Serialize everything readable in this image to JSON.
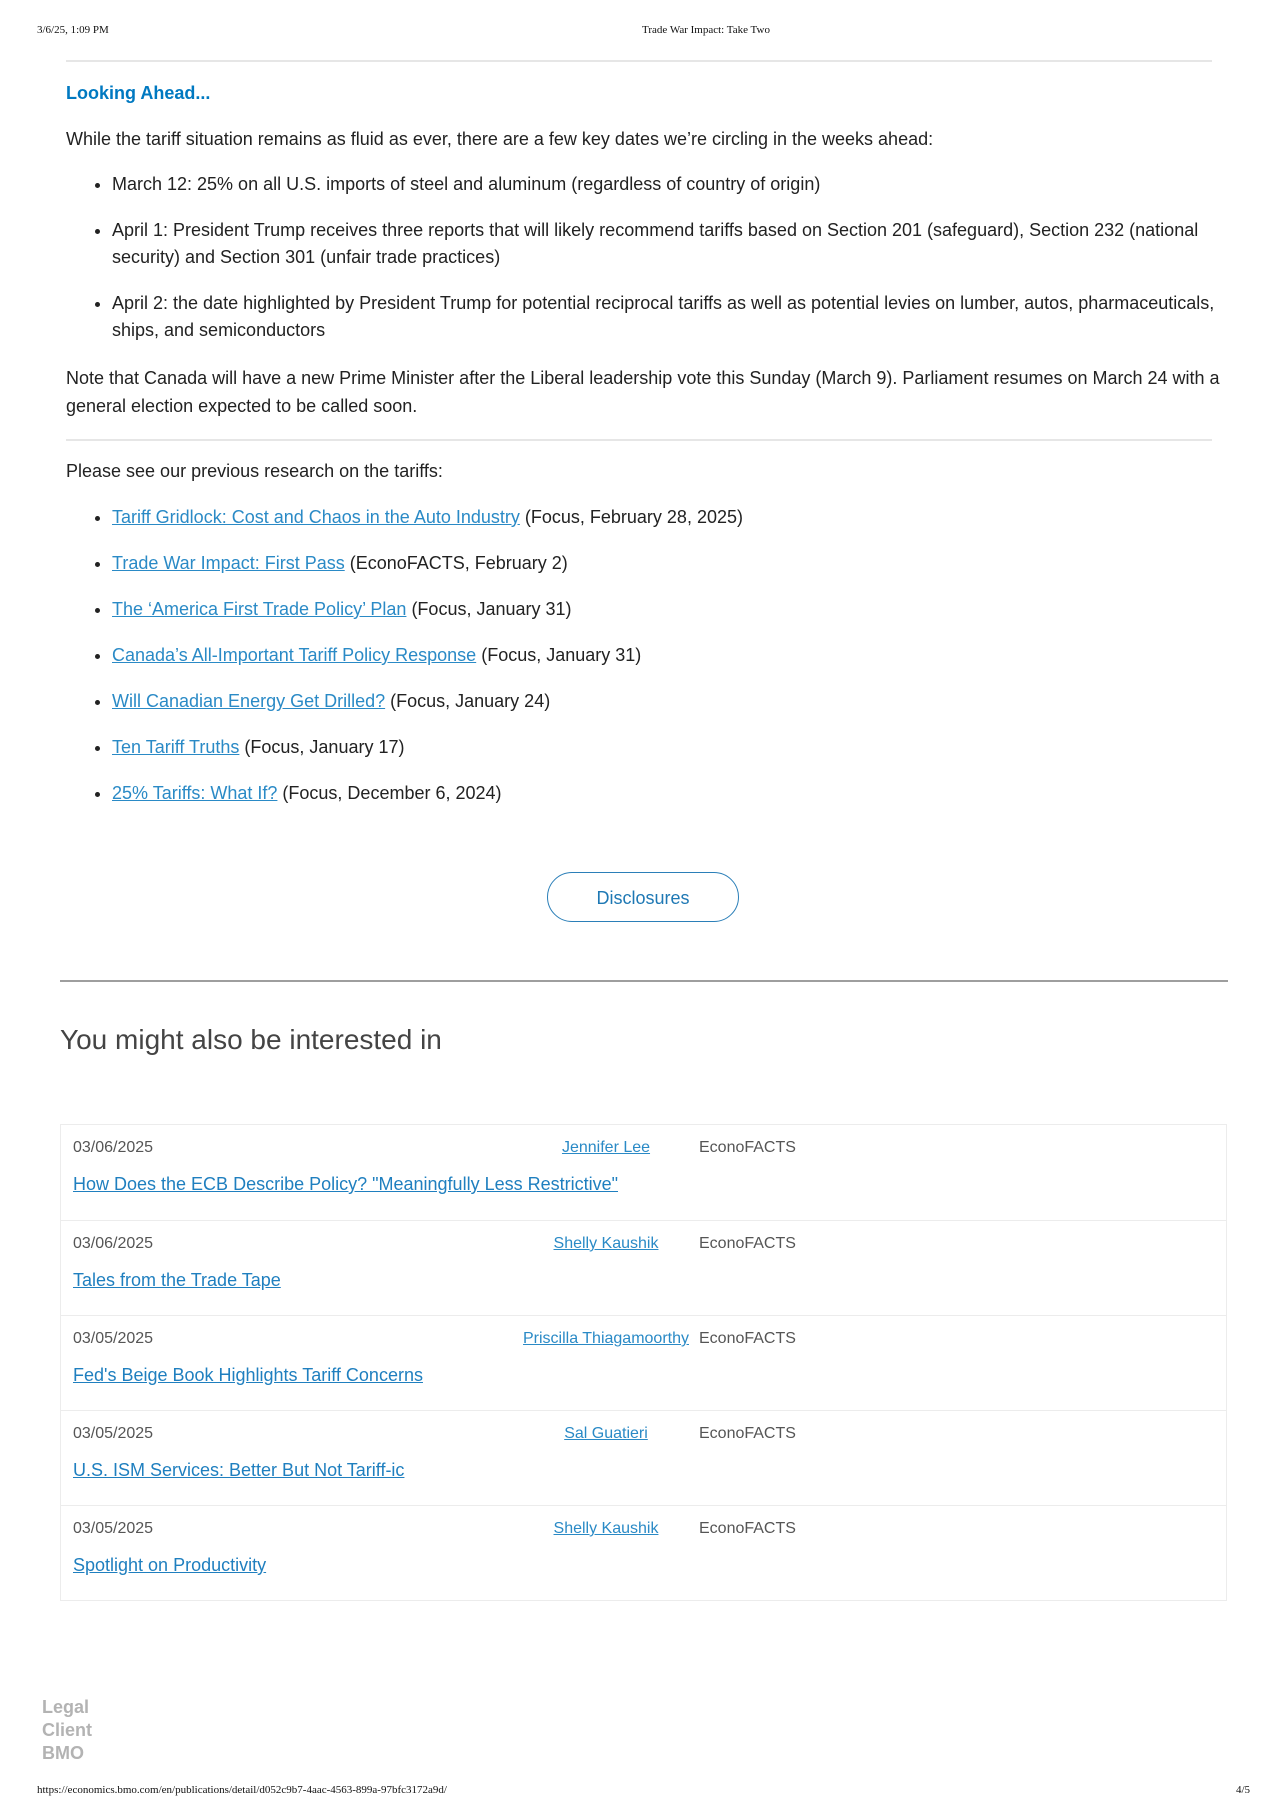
{
  "print_header": {
    "datetime": "3/6/25, 1:09 PM",
    "title": "Trade War Impact: Take Two"
  },
  "looking_ahead": {
    "heading": "Looking Ahead...",
    "intro": "While the tariff situation remains as fluid as ever, there are a few key dates we’re circling in the weeks ahead:",
    "bullets": [
      "March 12: 25% on all U.S. imports of steel and aluminum (regardless of country of origin)",
      "April 1: President Trump receives three reports that will likely recommend tariffs based on Section 201 (safeguard), Section 232 (national security) and Section 301 (unfair trade practices)",
      "April 2: the date highlighted by President Trump for potential reciprocal tariffs as well as potential levies on lumber, autos, pharmaceuticals, ships, and semiconductors"
    ],
    "note": "Note that Canada will have a new Prime Minister after the Liberal leadership vote this Sunday (March 9). Parliament resumes on March 24 with a general election expected to be called soon."
  },
  "previous_research": {
    "intro": "Please see our previous research on the tariffs:",
    "items": [
      {
        "link": "Tariff Gridlock: Cost and Chaos in the Auto Industry",
        "suffix": " (Focus, February 28, 2025)"
      },
      {
        "link": "Trade War Impact: First Pass",
        "suffix": " (EconoFACTS, February 2)"
      },
      {
        "link": "The ‘America First Trade Policy’ Plan",
        "suffix": " (Focus, January 31)"
      },
      {
        "link": "Canada’s All-Important Tariff Policy Response",
        "suffix": " (Focus, January 31)"
      },
      {
        "link": "Will Canadian Energy Get Drilled?",
        "suffix": " (Focus, January 24)"
      },
      {
        "link": "Ten Tariff Truths",
        "suffix": " (Focus, January 17)"
      },
      {
        "link": "25% Tariffs: What If?",
        "suffix": " (Focus, December 6, 2024)"
      }
    ]
  },
  "disclosures_button": "Disclosures",
  "related": {
    "heading": "You might also be interested in",
    "rows": [
      {
        "date": "03/06/2025",
        "author": "Jennifer Lee",
        "type": "EconoFACTS",
        "title": "How Does the ECB Describe Policy? \"Meaningfully Less Restrictive\""
      },
      {
        "date": "03/06/2025",
        "author": "Shelly Kaushik",
        "type": "EconoFACTS",
        "title": "Tales from the Trade Tape"
      },
      {
        "date": "03/05/2025",
        "author": "Priscilla Thiagamoorthy",
        "type": "EconoFACTS",
        "title": "Fed's Beige Book Highlights Tariff Concerns"
      },
      {
        "date": "03/05/2025",
        "author": "Sal Guatieri",
        "type": "EconoFACTS",
        "title": "U.S. ISM Services: Better But Not Tariff-ic"
      },
      {
        "date": "03/05/2025",
        "author": "Shelly Kaushik",
        "type": "EconoFACTS",
        "title": "Spotlight on Productivity"
      }
    ]
  },
  "footer": {
    "links": [
      "Legal",
      "Client",
      "BMO"
    ]
  },
  "print_footer": {
    "url": "https://economics.bmo.com/en/publications/detail/d052c9b7-4aac-4563-899a-97bfc3172a9d/",
    "page": "4/5"
  },
  "colors": {
    "accent": "#0079c1",
    "link": "#2a8ac6",
    "footer_gray": "#b3b3b3"
  }
}
